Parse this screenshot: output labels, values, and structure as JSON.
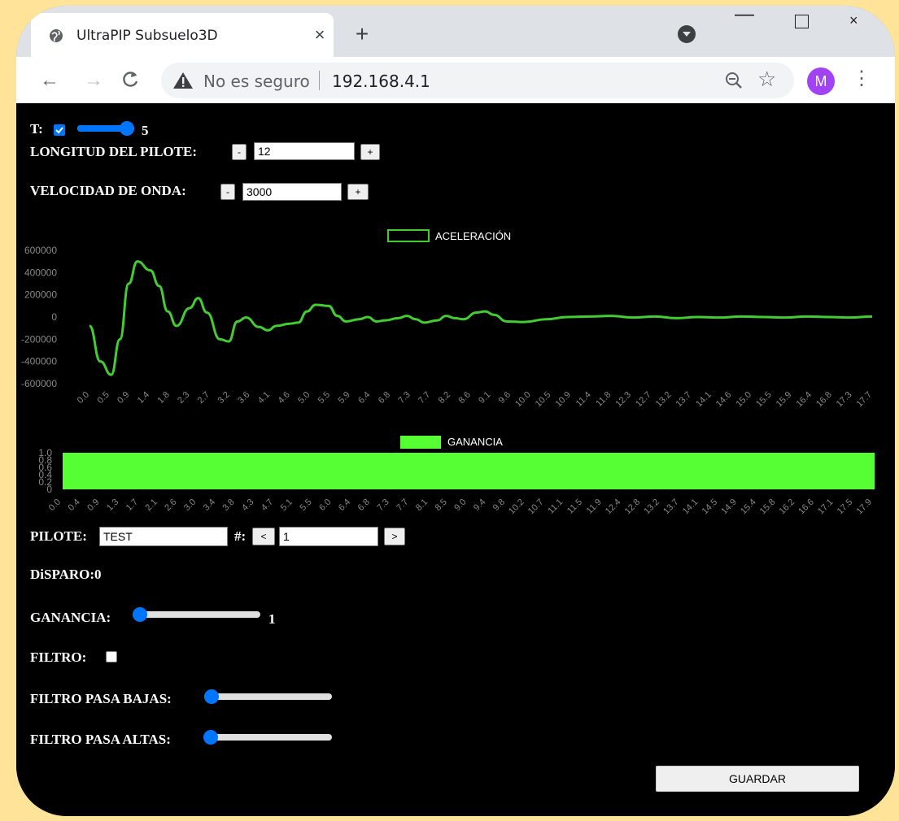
{
  "browser": {
    "tab_title": "UltraPIP Subsuelo3D",
    "tab_close": "×",
    "new_tab": "+",
    "security_label": "No es seguro",
    "url": "192.168.4.1",
    "profile_initial": "M",
    "back": "←",
    "forward": "→",
    "reload": "C",
    "menu": "⋮",
    "star": "☆",
    "min": "—",
    "close": "×"
  },
  "controls": {
    "t_label": "T:",
    "t_checked": true,
    "t_slider_value": "5",
    "t_slider_fraction": 1.0,
    "longitud_label": "LONGITUD DEL PILOTE:",
    "longitud_value": "12",
    "velocidad_label": "VELOCIDAD DE ONDA:",
    "velocidad_value": "3000",
    "minus": "-",
    "plus": "+"
  },
  "chart_data": [
    {
      "type": "line",
      "legend": [
        "ACELERACIÓN"
      ],
      "series": [
        {
          "name": "ACELERACIÓN",
          "color": "#44cc33"
        }
      ],
      "ylim": [
        -600000,
        600000
      ],
      "yticks": [
        "600000",
        "400000",
        "200000",
        "0",
        "-200000",
        "-400000",
        "-600000"
      ],
      "xticks": [
        "0.0",
        "0.5",
        "0.9",
        "1.4",
        "1.8",
        "2.3",
        "2.7",
        "3.2",
        "3.6",
        "4.1",
        "4.6",
        "5.0",
        "5.5",
        "5.9",
        "6.4",
        "6.8",
        "7.3",
        "7.7",
        "8.2",
        "8.6",
        "9.1",
        "9.6",
        "10.0",
        "10.5",
        "10.9",
        "11.4",
        "11.8",
        "12.3",
        "12.7",
        "13.2",
        "13.7",
        "14.1",
        "14.6",
        "15.0",
        "15.5",
        "15.9",
        "16.4",
        "16.8",
        "17.3",
        "17.7"
      ],
      "x": [
        0.0,
        0.25,
        0.5,
        0.7,
        0.9,
        1.1,
        1.4,
        1.6,
        1.8,
        2.0,
        2.3,
        2.5,
        2.7,
        3.0,
        3.2,
        3.4,
        3.6,
        3.9,
        4.1,
        4.3,
        4.6,
        4.8,
        5.0,
        5.2,
        5.5,
        5.7,
        5.9,
        6.2,
        6.4,
        6.6,
        6.8,
        7.1,
        7.3,
        7.5,
        7.7,
        8.0,
        8.2,
        8.4,
        8.6,
        8.9,
        9.1,
        9.3,
        9.6,
        10.0,
        10.5,
        11.0,
        11.5,
        12.0,
        12.5,
        13.0,
        13.5,
        14.0,
        14.5,
        15.0,
        15.5,
        16.0,
        16.5,
        17.0,
        17.5,
        18.0
      ],
      "y": [
        -80000,
        -400000,
        -520000,
        -200000,
        300000,
        500000,
        420000,
        280000,
        50000,
        -80000,
        80000,
        170000,
        40000,
        -200000,
        -220000,
        -40000,
        -5000,
        -90000,
        -120000,
        -80000,
        -60000,
        -50000,
        50000,
        110000,
        100000,
        10000,
        -40000,
        -20000,
        0,
        -40000,
        -30000,
        -10000,
        10000,
        -20000,
        -50000,
        -30000,
        10000,
        -10000,
        -20000,
        40000,
        50000,
        20000,
        -40000,
        -45000,
        -20000,
        0,
        5000,
        10000,
        -5000,
        5000,
        -10000,
        0,
        -5000,
        5000,
        0,
        -5000,
        5000,
        0,
        -5000,
        5000
      ]
    },
    {
      "type": "bar",
      "legend": [
        "GANANCIA"
      ],
      "series": [
        {
          "name": "GANANCIA",
          "color": "#55ff33"
        }
      ],
      "ylim": [
        0,
        1
      ],
      "yticks": [
        "1.0",
        "0.8",
        "0.6",
        "0.4",
        "0.2",
        "0"
      ],
      "xticks": [
        "0.0",
        "0.4",
        "0.9",
        "1.3",
        "1.7",
        "2.1",
        "2.6",
        "3.0",
        "3.4",
        "3.8",
        "4.3",
        "4.7",
        "5.1",
        "5.5",
        "6.0",
        "6.4",
        "6.8",
        "7.3",
        "7.7",
        "8.1",
        "8.5",
        "9.0",
        "9.4",
        "9.8",
        "10.2",
        "10.7",
        "11.1",
        "11.5",
        "11.9",
        "12.4",
        "12.8",
        "13.2",
        "13.7",
        "14.1",
        "14.5",
        "14.9",
        "15.4",
        "15.8",
        "16.2",
        "16.6",
        "17.1",
        "17.5",
        "17.9"
      ],
      "value": 1
    }
  ],
  "pilote": {
    "label": "PILOTE:",
    "value": "TEST",
    "num_label": "#:",
    "prev": "<",
    "next": ">",
    "num_value": "1"
  },
  "disparo": {
    "label": "DiSPARO:0"
  },
  "ganancia": {
    "label": "GANANCIA:",
    "value": "1",
    "fraction": 0.0
  },
  "filtro": {
    "label": "FILTRO:",
    "checked": false
  },
  "pasa_bajas": {
    "label": "FILTRO PASA BAJAS:",
    "fraction": 0.0
  },
  "pasa_altas": {
    "label": "FILTRO PASA ALTAS:",
    "fraction": 0.0
  },
  "save": {
    "label": "GUARDAR"
  }
}
